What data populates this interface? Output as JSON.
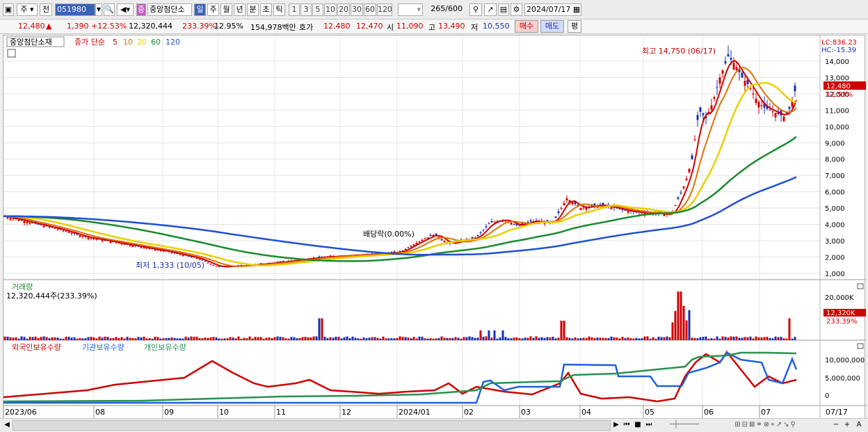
{
  "toolbar": {
    "period": "주",
    "prev": "전",
    "code": "051980",
    "name": "중앙첨단소",
    "period_buttons": [
      "일",
      "주",
      "월",
      "년",
      "분",
      "초",
      "틱"
    ],
    "minute_buttons": [
      "1",
      "3",
      "5",
      "10",
      "20",
      "30",
      "60",
      "120"
    ],
    "count": "265",
    "count_max": "/600",
    "date": "2024/07/17",
    "icon_color": "#c060c0"
  },
  "quote": {
    "price": "12,480",
    "arrow": "▲",
    "change": "1,390",
    "change_pct": "+12.53%",
    "volume": "12,320,444",
    "vol_ratio": "233.39%",
    "turnover": "12.95%",
    "amount": "154,978백만",
    "hoga_label": "호가",
    "ask": "12,480",
    "bid": "12,470",
    "open_label": "시",
    "open": "11,090",
    "high_label": "고",
    "high": "13,490",
    "low_label": "저",
    "low": "10,550",
    "buy": "매수",
    "sell": "매도",
    "avg": "평"
  },
  "price_panel": {
    "stock": "중앙첨단소재",
    "ma_label": "종가 단순",
    "ma_periods": [
      "5",
      "10",
      "20",
      "60",
      "120"
    ],
    "ma_colors": [
      "#d00000",
      "#e07000",
      "#e8d000",
      "#1a8a30",
      "#2050d0"
    ],
    "lc": "LC:836.23",
    "hc": "HC:-15.39",
    "high_note": "최고 14,750 (06/17)",
    "low_note": "최저 1,333 (10/05)",
    "div_note": "배당락(0.00%)",
    "cur_price": "12,480",
    "cur_pct": "12.53%",
    "y_ticks": [
      "14,000",
      "13,000",
      "12,000",
      "11,000",
      "10,000",
      "9,000",
      "8,000",
      "7,000",
      "6,000",
      "5,000",
      "4,000",
      "3,000",
      "2,000",
      "1,000"
    ]
  },
  "volume_panel": {
    "title": "거래량",
    "value": "12,320,444주(233.39%)",
    "tick": "20,000K",
    "cur": "12,320K",
    "cur_pct": "233.39%"
  },
  "holder_panel": {
    "labels": [
      "외국인보유수량",
      "기관보유수량",
      "개인보유수량"
    ],
    "colors": [
      "#d00000",
      "#2060d8",
      "#2a9050"
    ],
    "ticks": [
      "10,000,000",
      "5,000,000",
      "0"
    ]
  },
  "xaxis": {
    "labels": [
      "2023/06",
      "08",
      "09",
      "10",
      "11",
      "12",
      "2024/01",
      "02",
      "03",
      "04",
      "05",
      "06",
      "07"
    ],
    "last": "07/17"
  }
}
